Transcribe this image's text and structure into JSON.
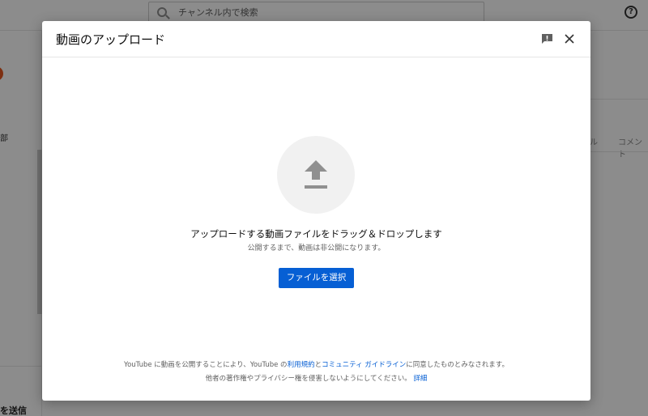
{
  "background": {
    "search": {
      "placeholder": "チャンネル内で検索"
    },
    "help_icon_glyph": "?",
    "sidebar": {
      "partial_text_1": "部",
      "partial_text_2": "を送信"
    },
    "right": {
      "partial_tab_1": "ル",
      "partial_tab_2": "コメント"
    }
  },
  "dialog": {
    "title": "動画のアップロード",
    "icons": {
      "feedback": "feedback-icon",
      "close": "close-icon",
      "upload": "upload-arrow-icon"
    },
    "main_text": "アップロードする動画ファイルをドラッグ＆ドロップします",
    "sub_text": "公開するまで、動画は非公開になります。",
    "select_button": "ファイルを選択",
    "footer": {
      "line1_prefix": "YouTube に動画を公開することにより、YouTube の",
      "terms_link": "利用規約",
      "line1_and": "と",
      "guidelines_link": "コミュニティ ガイドライン",
      "line1_suffix": "に同意したものとみなされます。",
      "line2_text": "他者の著作権やプライバシー権を侵害しないようにしてください。",
      "details_link": "詳細"
    }
  },
  "colors": {
    "accent": "#065fd4",
    "overlay": "rgba(0,0,0,0.45)"
  }
}
